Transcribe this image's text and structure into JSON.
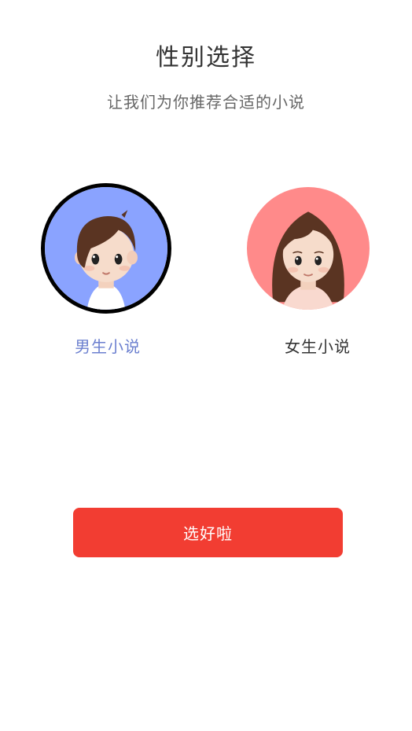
{
  "header": {
    "title": "性别选择",
    "subtitle": "让我们为你推荐合适的小说"
  },
  "options": [
    {
      "label": "男生小说",
      "icon": "male-avatar-icon",
      "selected": true,
      "bg_color": "#8aa3ff",
      "label_color": "#6b7fcf"
    },
    {
      "label": "女生小说",
      "icon": "female-avatar-icon",
      "selected": false,
      "bg_color": "#ff8a8a",
      "label_color": "#333333"
    }
  ],
  "confirm": {
    "label": "选好啦",
    "color": "#f23d32"
  }
}
